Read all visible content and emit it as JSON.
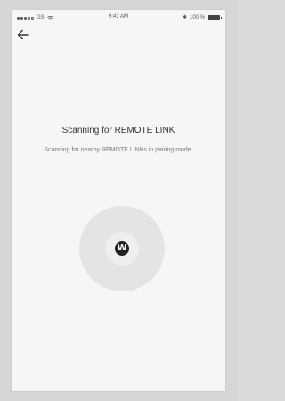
{
  "status_bar": {
    "carrier": "GS",
    "time": "9:41 AM",
    "battery_percent": "100 %",
    "bluetooth_symbol": "✱"
  },
  "navigation": {
    "back_icon": "arrow-left-icon"
  },
  "main": {
    "title": "Scanning for REMOTE LINK",
    "subtitle": "Scanning for nearby REMOTE LINKs in pairing mode.",
    "logo_letter": "W"
  },
  "colors": {
    "background": "#f6f6f6",
    "scan_outer": "#e4e4e4",
    "scan_inner": "#eeeeee",
    "logo": "#222222"
  }
}
